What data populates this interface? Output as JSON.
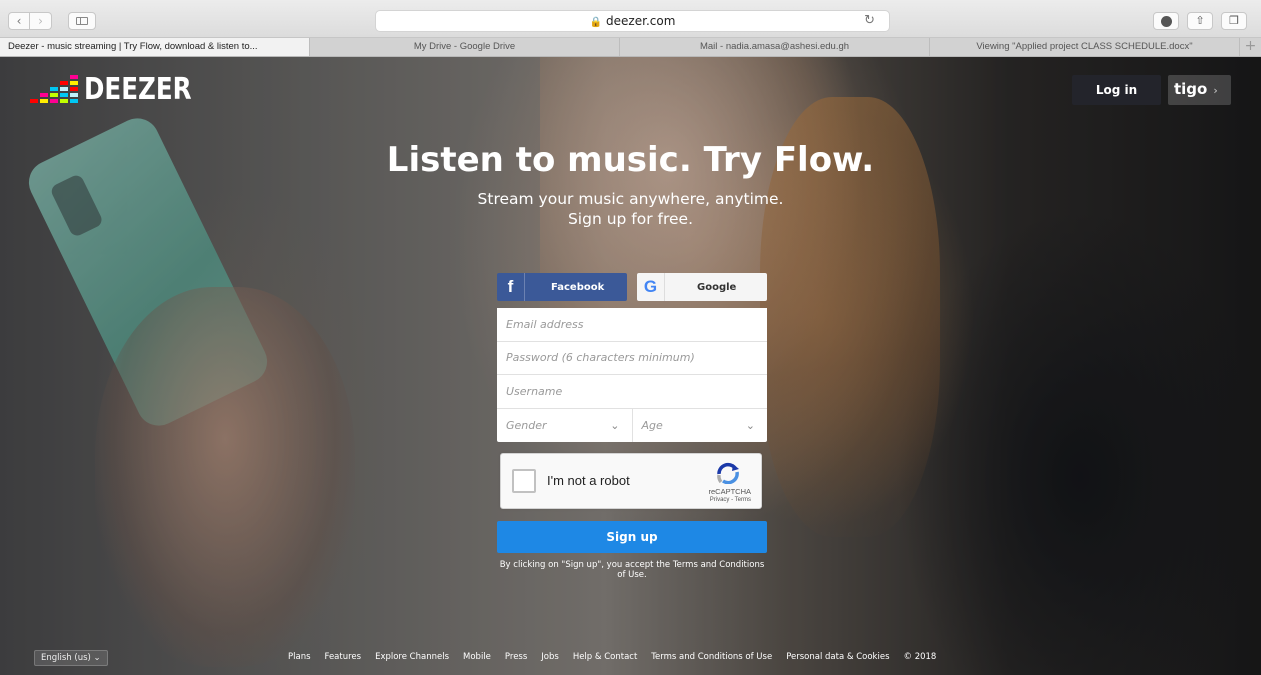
{
  "browser": {
    "url": "deezer.com",
    "tabs": [
      {
        "label": "Deezer - music streaming | Try Flow, download & listen to..."
      },
      {
        "label": "My Drive - Google Drive"
      },
      {
        "label": "Mail - nadia.amasa@ashesi.edu.gh"
      },
      {
        "label": "Viewing \"Applied project CLASS SCHEDULE.docx\""
      }
    ],
    "icons": [
      "back-icon",
      "forward-icon",
      "sidebar-icon",
      "lock-icon",
      "reload-icon",
      "download-icon",
      "share-icon",
      "tabs-icon",
      "new-tab-icon"
    ]
  },
  "header": {
    "logo_text": "DEEZER",
    "login_label": "Log in",
    "partner_label": "tigo",
    "logo_colors": [
      "#ff0000",
      "#ffed00",
      "#ff0092",
      "#c2ff00",
      "#00c7f2",
      "#c1f1fc"
    ]
  },
  "hero": {
    "headline": "Listen to music. Try Flow.",
    "subline_1": "Stream your music anywhere, anytime.",
    "subline_2": "Sign up for free."
  },
  "form": {
    "facebook_label": "Facebook",
    "google_label": "Google",
    "email_placeholder": "Email address",
    "password_placeholder": "Password (6 characters minimum)",
    "username_placeholder": "Username",
    "gender_placeholder": "Gender",
    "age_placeholder": "Age",
    "captcha_label": "I'm not a robot",
    "captcha_brand": "reCAPTCHA",
    "captcha_links": "Privacy - Terms",
    "signup_label": "Sign up",
    "terms_text": "By clicking on \"Sign up\", you accept the Terms and Conditions of Use.",
    "colors": {
      "facebook": "#3b5998",
      "signup": "#1e88e5"
    }
  },
  "footer": {
    "language": "English (us)",
    "links": [
      "Plans",
      "Features",
      "Explore Channels",
      "Mobile",
      "Press",
      "Jobs",
      "Help & Contact",
      "Terms and Conditions of Use",
      "Personal data & Cookies",
      "© 2018"
    ]
  }
}
